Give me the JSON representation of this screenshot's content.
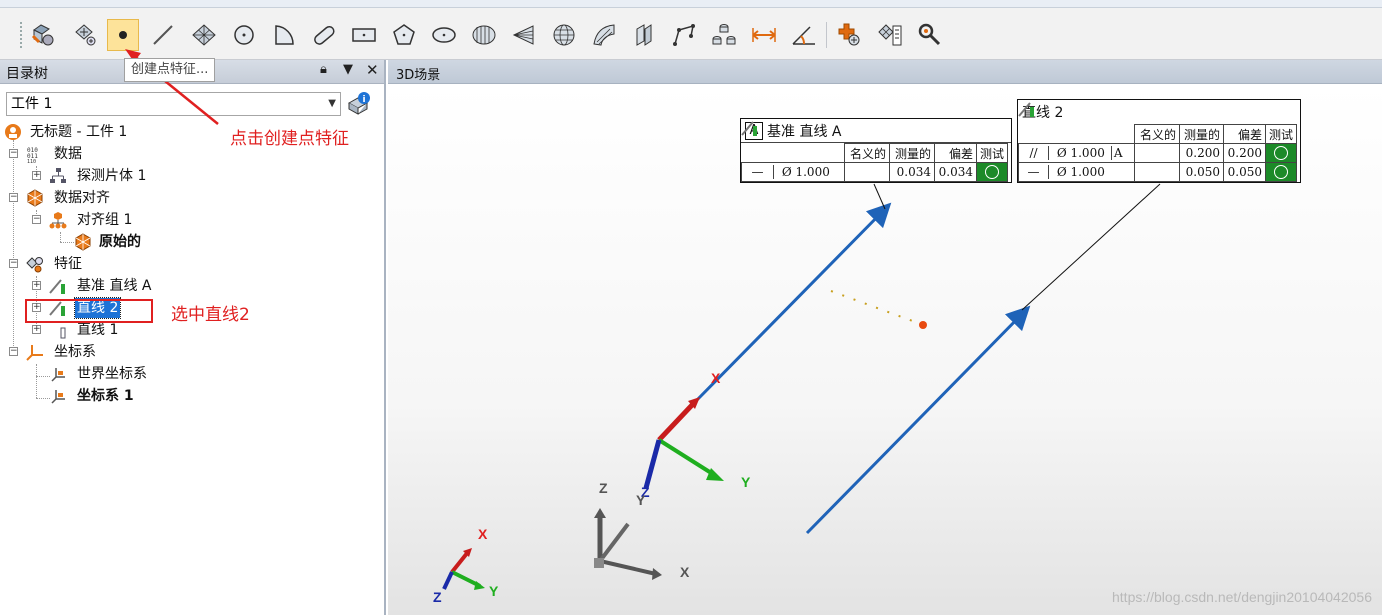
{
  "toolbar": {
    "tooltip": "创建点特征...",
    "buttons": [
      {
        "name": "probe-feature-button",
        "icon": "probe-icon"
      },
      {
        "name": "point-cloud-button",
        "icon": "points-icon"
      },
      {
        "name": "create-point-button",
        "icon": "point-icon",
        "active": true
      },
      {
        "name": "create-line-button",
        "icon": "line-icon"
      },
      {
        "name": "create-plane-button",
        "icon": "plane-icon"
      },
      {
        "name": "create-circle-button",
        "icon": "circle-icon"
      },
      {
        "name": "create-arc-button",
        "icon": "arc-icon"
      },
      {
        "name": "create-slot-button",
        "icon": "slot-icon"
      },
      {
        "name": "create-rect-slot-button",
        "icon": "rect-slot-icon"
      },
      {
        "name": "create-polygon-button",
        "icon": "polygon-icon"
      },
      {
        "name": "create-ellipse-button",
        "icon": "ellipse-icon"
      },
      {
        "name": "create-cylinder-button",
        "icon": "cylinder-icon"
      },
      {
        "name": "create-cone-button",
        "icon": "cone-icon"
      },
      {
        "name": "create-sphere-button",
        "icon": "sphere-icon"
      },
      {
        "name": "create-surface-button",
        "icon": "surface-icon"
      },
      {
        "name": "create-section-button",
        "icon": "section-icon"
      },
      {
        "name": "create-polyline-button",
        "icon": "polyline-icon"
      },
      {
        "name": "create-set-button",
        "icon": "set-icon"
      },
      {
        "name": "create-distance-button",
        "icon": "distance-icon"
      },
      {
        "name": "create-angle-button",
        "icon": "angle-icon"
      },
      {
        "name": "construct-feature-button",
        "icon": "construct-icon"
      },
      {
        "name": "feature-list-button",
        "icon": "feature-list-icon"
      },
      {
        "name": "settings-tools-button",
        "icon": "tools-icon"
      }
    ]
  },
  "left_panel": {
    "title": "目录树",
    "combo_value": "工件 1",
    "tree": {
      "root": "无标题 - 工件 1",
      "data": "数据",
      "probe_body": "探测片体 1",
      "alignment": "数据对齐",
      "align_group": "对齐组 1",
      "original": "原始的",
      "features": "特征",
      "datum_line_a": "基准 直线 A",
      "line2": "直线 2",
      "line1": "直线 1",
      "coord_systems": "坐标系",
      "world_cs": "世界坐标系",
      "cs1": "坐标系 1"
    }
  },
  "scene": {
    "title": "3D场景",
    "fcf1": {
      "datum": "A",
      "title": "基准 直线 A",
      "headers": [
        "名义的",
        "测量的",
        "偏差",
        "测试"
      ],
      "row": {
        "symbol": "—",
        "value": "Ø 1.000",
        "nominal": "",
        "measured": "0.034",
        "deviation": "0.034"
      }
    },
    "fcf2": {
      "title": "直线 2",
      "headers": [
        "名义的",
        "测量的",
        "偏差",
        "测试"
      ],
      "rows": [
        {
          "symbol": "//",
          "value": "Ø 1.000",
          "datum": "A",
          "measured": "0.200",
          "deviation": "0.200"
        },
        {
          "symbol": "—",
          "value": "Ø 1.000",
          "datum": "",
          "measured": "0.050",
          "deviation": "0.050"
        }
      ]
    },
    "axes_labels": {
      "x": "X",
      "y": "Y",
      "z": "Z"
    },
    "watermark": "https://blog.csdn.net/dengjin20104042056"
  },
  "annotations": {
    "click_point": "点击创建点特征",
    "select_line": "选中直线2"
  },
  "colors": {
    "accent_red": "#e02020",
    "line_blue": "#1f63b8",
    "pass_green": "#1c8a28",
    "selection": "#1e73d6"
  }
}
